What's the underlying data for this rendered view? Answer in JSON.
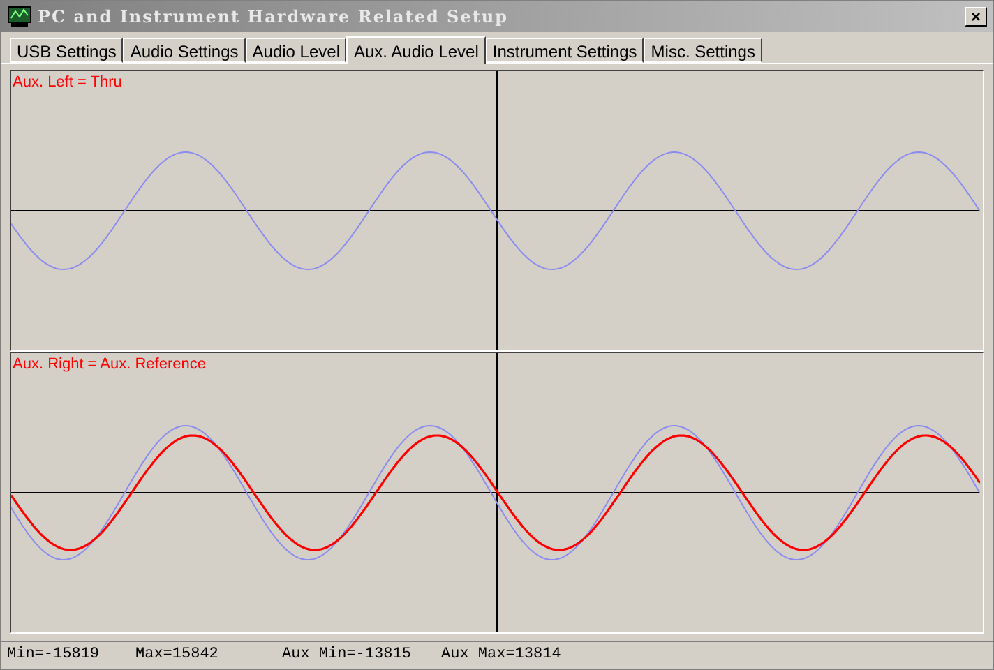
{
  "window": {
    "title": "PC and Instrument Hardware Related Setup",
    "close": "×"
  },
  "tabs": [
    {
      "label": "USB Settings",
      "selected": false
    },
    {
      "label": "Audio Settings",
      "selected": false
    },
    {
      "label": "Audio Level",
      "selected": false
    },
    {
      "label": "Aux. Audio Level",
      "selected": true
    },
    {
      "label": "Instrument Settings",
      "selected": false
    },
    {
      "label": "Misc. Settings",
      "selected": false
    }
  ],
  "plots": [
    {
      "label": "Aux. Left = Thru",
      "traces": [
        {
          "kind": "thin",
          "color": "#8c8cf0"
        }
      ]
    },
    {
      "label": "Aux. Right = Aux. Reference",
      "traces": [
        {
          "kind": "thin",
          "color": "#8c8cf0"
        },
        {
          "kind": "thick",
          "color": "#ff0000"
        }
      ]
    }
  ],
  "status_bar": [
    "Min=-15819",
    "Max=15842",
    "Aux Min=-13815",
    "Aux Max=13814"
  ]
}
